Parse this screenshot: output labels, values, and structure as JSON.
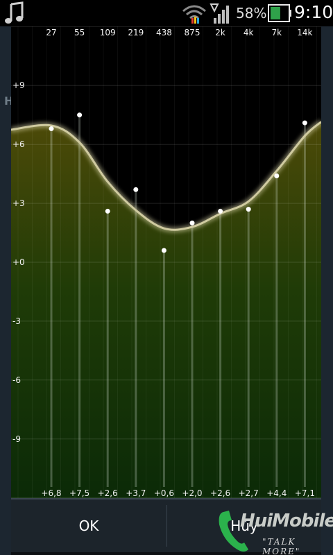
{
  "status_bar": {
    "battery_percent": "58%",
    "time": "9:10",
    "icons": [
      "music-note-icon",
      "wifi-icon",
      "signal-icon",
      "battery-icon"
    ],
    "battery_level": 0.58
  },
  "background": {
    "peek_text": "H"
  },
  "equalizer": {
    "band_frequencies": [
      "27",
      "55",
      "109",
      "219",
      "438",
      "875",
      "2k",
      "4k",
      "7k",
      "14k"
    ],
    "band_gains": [
      "+6,8",
      "+7,5",
      "+2,6",
      "+3,7",
      "+0,6",
      "+2,0",
      "+2,6",
      "+2,7",
      "+4,4",
      "+7,1"
    ],
    "band_gain_values": [
      6.8,
      7.5,
      2.6,
      3.7,
      0.6,
      2.0,
      2.6,
      2.7,
      4.4,
      7.1
    ],
    "axis_labels": [
      "+9",
      "+6",
      "+3",
      "+0",
      "-3",
      "-6",
      "-9"
    ],
    "axis_values": [
      9,
      6,
      3,
      0,
      -3,
      -6,
      -9
    ],
    "range": [
      -12,
      12
    ],
    "colors": {
      "fill_top": "#4d4a08",
      "fill_bottom": "#0b2a07",
      "curve": "#cfcaa0",
      "handle": "#ffffff"
    }
  },
  "dialog": {
    "ok_label": "OK",
    "cancel_label": "Hủy"
  },
  "watermark": {
    "brand": "HuiMobile",
    "tagline": "\"TALK MORE\""
  }
}
